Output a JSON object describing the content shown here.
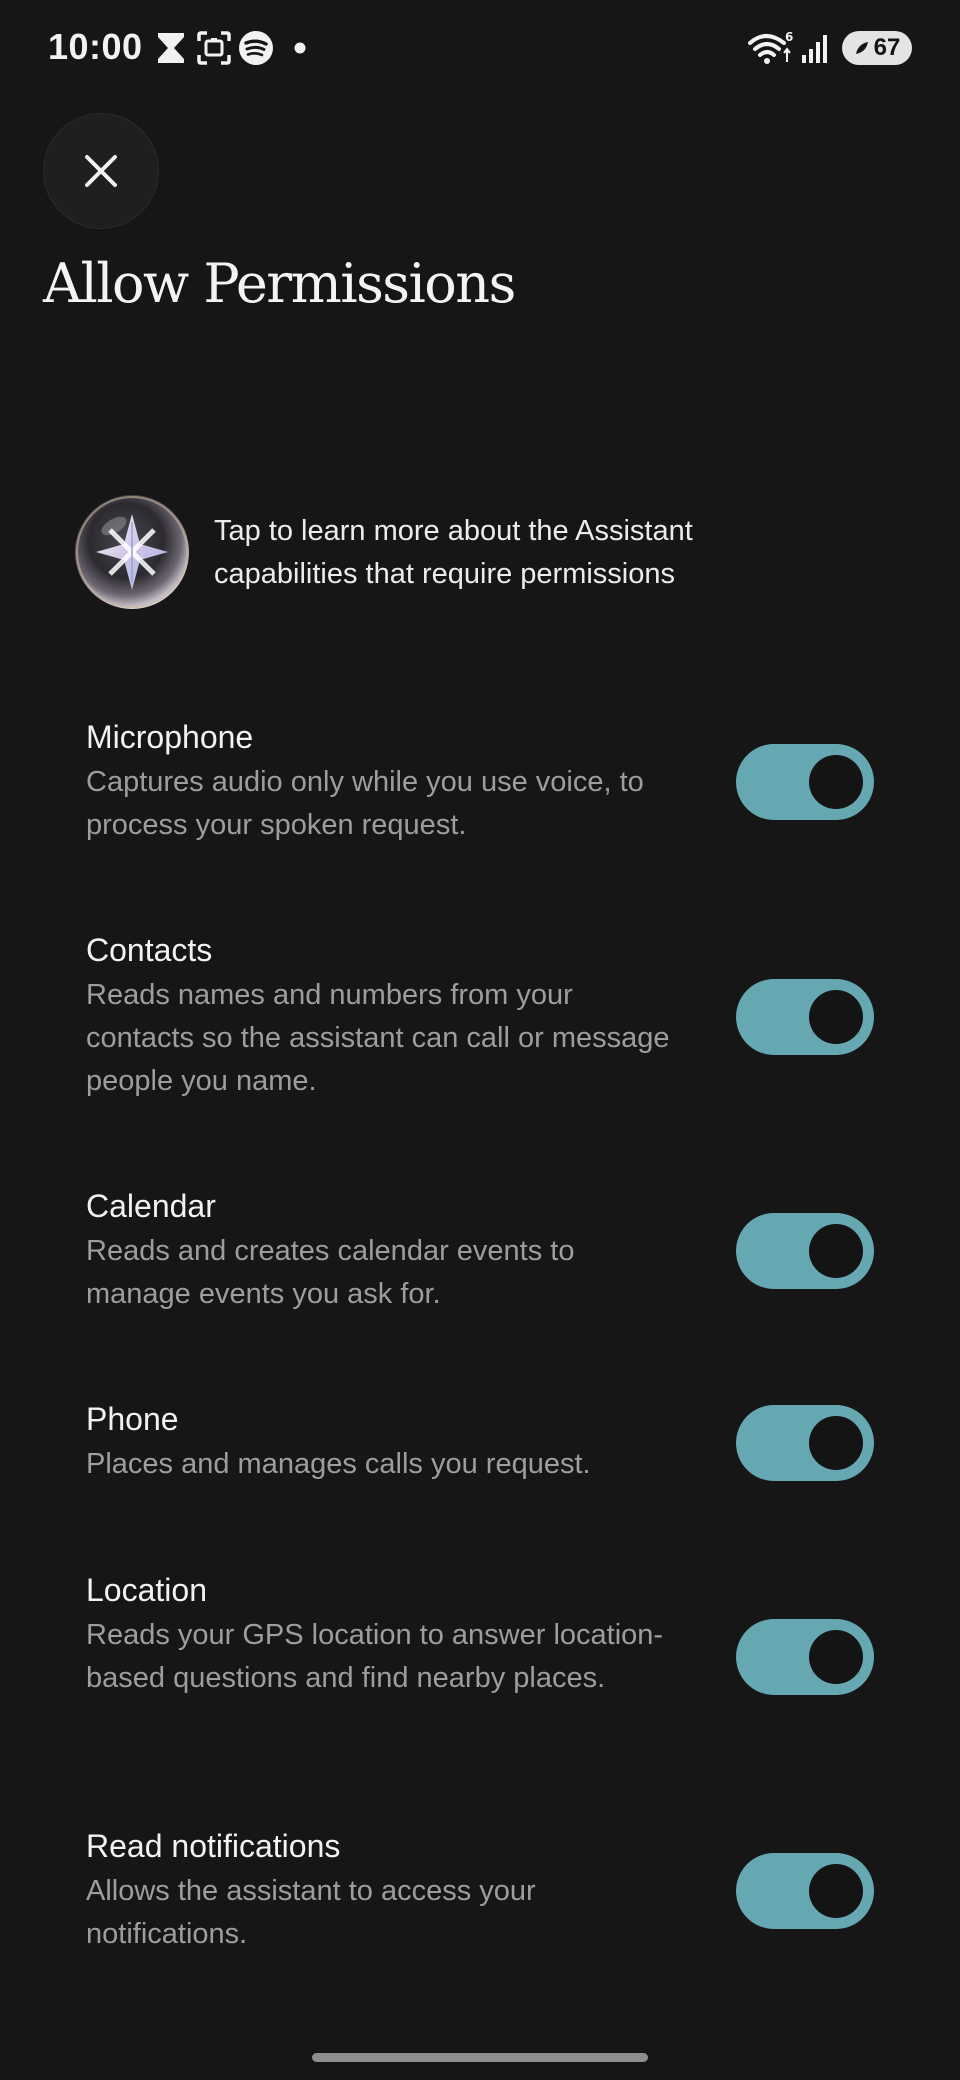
{
  "status_bar": {
    "time": "10:00",
    "battery_level": "67",
    "notification_icons": [
      "hourglass-icon",
      "screenshot-icon",
      "spotify-icon",
      "dot-icon"
    ],
    "system_icons": [
      "wifi-6-icon",
      "cellular-signal-icon",
      "battery-saver-icon"
    ]
  },
  "header": {
    "close_icon": "close-icon",
    "title": "Allow Permissions"
  },
  "info": {
    "icon": "assistant-orb-icon",
    "text": "Tap to learn more about the Assistant capabilities that require permissions"
  },
  "permissions": [
    {
      "title": "Microphone",
      "description": "Captures audio only while you use voice, to process your spoken request.",
      "enabled": true
    },
    {
      "title": "Contacts",
      "description": "Reads names and numbers from your contacts so the assistant can call or message people you name.",
      "enabled": true
    },
    {
      "title": "Calendar",
      "description": "Reads and creates calendar events to manage events you ask for.",
      "enabled": true
    },
    {
      "title": "Phone",
      "description": "Places and manages calls you request.",
      "enabled": true
    },
    {
      "title": "Location",
      "description": "Reads your GPS location to answer location-based questions and find nearby places.",
      "enabled": true
    },
    {
      "title": "Read notifications",
      "description": "Allows the assistant to access your notifications.",
      "enabled": true
    }
  ],
  "colors": {
    "background": "#161616",
    "toggle_on": "#66a8b1",
    "secondary_text": "#9d9d9d"
  }
}
